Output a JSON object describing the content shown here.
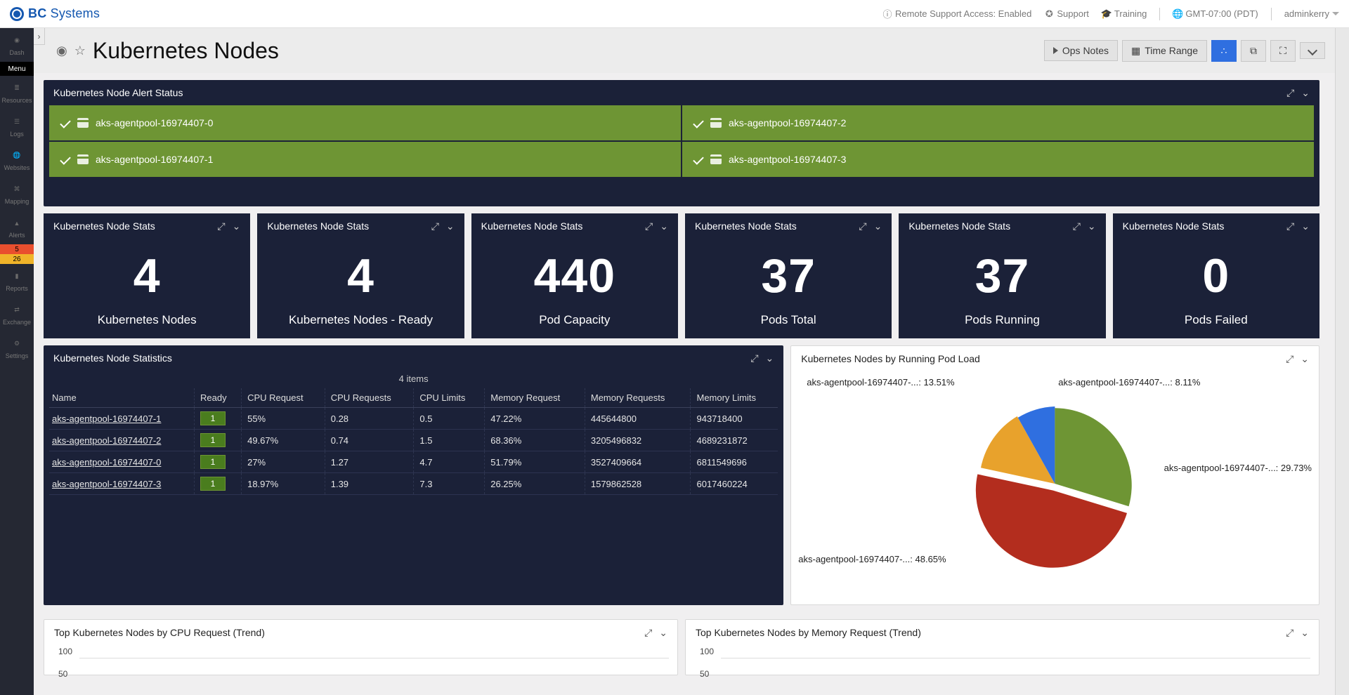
{
  "header": {
    "brand_prefix": "BC",
    "brand_suffix": "Systems",
    "remote_support": "Remote Support Access: Enabled",
    "support": "Support",
    "training": "Training",
    "timezone": "GMT-07:00 (PDT)",
    "user": "adminkerry"
  },
  "nav": {
    "items": [
      "Dash",
      "Menu",
      "Resources",
      "Logs",
      "Websites",
      "Mapping",
      "Alerts",
      "Reports",
      "Exchange",
      "Settings"
    ],
    "alert_counts": {
      "error": "5",
      "warn": "26"
    }
  },
  "page": {
    "title": "Kubernetes Nodes",
    "ops_notes": "Ops Notes",
    "time_range": "Time Range"
  },
  "alert_status": {
    "title": "Kubernetes Node Alert Status",
    "cells": [
      "aks-agentpool-16974407-0",
      "aks-agentpool-16974407-2",
      "aks-agentpool-16974407-1",
      "aks-agentpool-16974407-3"
    ]
  },
  "stats": {
    "title": "Kubernetes Node Stats",
    "cards": [
      {
        "value": "4",
        "label": "Kubernetes Nodes"
      },
      {
        "value": "4",
        "label": "Kubernetes Nodes - Ready"
      },
      {
        "value": "440",
        "label": "Pod Capacity"
      },
      {
        "value": "37",
        "label": "Pods Total"
      },
      {
        "value": "37",
        "label": "Pods Running"
      },
      {
        "value": "0",
        "label": "Pods Failed"
      }
    ]
  },
  "table": {
    "title": "Kubernetes Node Statistics",
    "items_label": "4 items",
    "columns": [
      "Name",
      "Ready",
      "CPU Request",
      "CPU Requests",
      "CPU Limits",
      "Memory Request",
      "Memory Requests",
      "Memory Limits"
    ],
    "rows": [
      {
        "name": "aks-agentpool-16974407-1",
        "ready": "1",
        "cpu_req": "55%",
        "cpu_reqs": "0.28",
        "cpu_lim": "0.5",
        "mem_req": "47.22%",
        "mem_reqs": "445644800",
        "mem_lim": "943718400"
      },
      {
        "name": "aks-agentpool-16974407-2",
        "ready": "1",
        "cpu_req": "49.67%",
        "cpu_reqs": "0.74",
        "cpu_lim": "1.5",
        "mem_req": "68.36%",
        "mem_reqs": "3205496832",
        "mem_lim": "4689231872"
      },
      {
        "name": "aks-agentpool-16974407-0",
        "ready": "1",
        "cpu_req": "27%",
        "cpu_reqs": "1.27",
        "cpu_lim": "4.7",
        "mem_req": "51.79%",
        "mem_reqs": "3527409664",
        "mem_lim": "6811549696"
      },
      {
        "name": "aks-agentpool-16974407-3",
        "ready": "1",
        "cpu_req": "18.97%",
        "cpu_reqs": "1.39",
        "cpu_lim": "7.3",
        "mem_req": "26.25%",
        "mem_reqs": "1579862528",
        "mem_lim": "6017460224"
      }
    ]
  },
  "pie": {
    "title": "Kubernetes Nodes by Running Pod Load",
    "labels": [
      "aks-agentpool-16974407-...: 13.51%",
      "aks-agentpool-16974407-...: 8.11%",
      "aks-agentpool-16974407-...: 29.73%",
      "aks-agentpool-16974407-...: 48.65%"
    ]
  },
  "trends": {
    "cpu_title": "Top Kubernetes Nodes by CPU Request (Trend)",
    "mem_title": "Top Kubernetes Nodes by Memory Request (Trend)",
    "y_100": "100",
    "y_50": "50"
  },
  "chart_data": [
    {
      "type": "pie",
      "title": "Kubernetes Nodes by Running Pod Load",
      "series": [
        {
          "name": "aks-agentpool-16974407-0",
          "value": 13.51,
          "color": "#e8a22c"
        },
        {
          "name": "aks-agentpool-16974407-1",
          "value": 8.11,
          "color": "#2f6fe0"
        },
        {
          "name": "aks-agentpool-16974407-2",
          "value": 29.73,
          "color": "#6e9534"
        },
        {
          "name": "aks-agentpool-16974407-3",
          "value": 48.65,
          "color": "#b32d1e"
        }
      ]
    },
    {
      "type": "line",
      "title": "Top Kubernetes Nodes by CPU Request (Trend)",
      "ylabel": "",
      "ylim": [
        0,
        100
      ],
      "series": []
    },
    {
      "type": "line",
      "title": "Top Kubernetes Nodes by Memory Request (Trend)",
      "ylabel": "",
      "ylim": [
        0,
        100
      ],
      "series": []
    }
  ]
}
